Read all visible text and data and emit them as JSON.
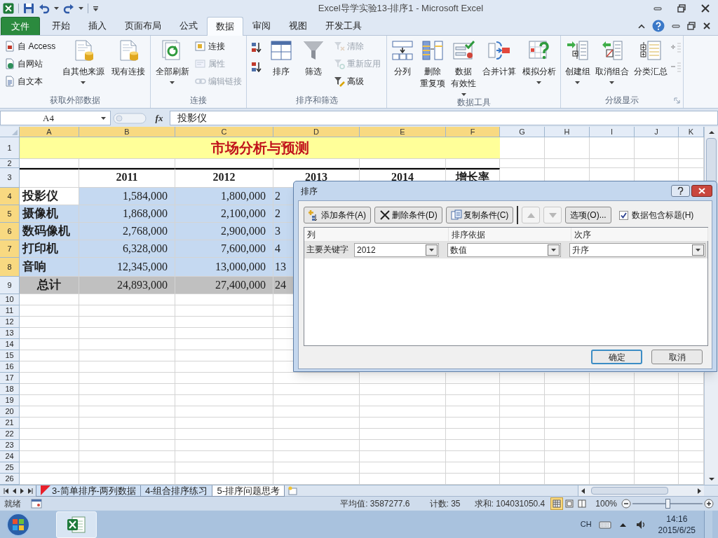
{
  "window": {
    "title": "Excel导学实验13-排序1  -  Microsoft Excel"
  },
  "ribbon_tabs": [
    {
      "label": "文件",
      "kind": "file",
      "selected": false
    },
    {
      "label": "开始",
      "kind": "tab",
      "selected": false
    },
    {
      "label": "插入",
      "kind": "tab",
      "selected": false
    },
    {
      "label": "页面布局",
      "kind": "tab",
      "selected": false
    },
    {
      "label": "公式",
      "kind": "tab",
      "selected": false
    },
    {
      "label": "数据",
      "kind": "tab",
      "selected": true
    },
    {
      "label": "审阅",
      "kind": "tab",
      "selected": false
    },
    {
      "label": "视图",
      "kind": "tab",
      "selected": false
    },
    {
      "label": "开发工具",
      "kind": "tab",
      "selected": false
    }
  ],
  "ribbon_groups": [
    {
      "label": "获取外部数据",
      "launcher": false,
      "items": [
        {
          "kind": "stack",
          "items": [
            {
              "label": "自 Access",
              "disabled": false
            },
            {
              "label": "自网站",
              "disabled": false
            },
            {
              "label": "自文本",
              "disabled": false
            }
          ]
        },
        {
          "kind": "large",
          "label": "自其他来源",
          "dropdown": true
        },
        {
          "kind": "large",
          "label": "现有连接",
          "dropdown": false
        }
      ]
    },
    {
      "label": "连接",
      "launcher": false,
      "items": [
        {
          "kind": "large",
          "label": "全部刷新",
          "dropdown": true
        },
        {
          "kind": "stack",
          "items": [
            {
              "label": "连接",
              "disabled": false
            },
            {
              "label": "属性",
              "disabled": true
            },
            {
              "label": "编辑链接",
              "disabled": true
            }
          ]
        }
      ]
    },
    {
      "label": "排序和筛选",
      "launcher": false,
      "items": [
        {
          "kind": "icon-stack",
          "items": [
            {
              "disabled": false
            },
            {
              "disabled": false
            }
          ]
        },
        {
          "kind": "large",
          "label": "排序",
          "dropdown": false
        },
        {
          "kind": "large",
          "label": "筛选",
          "dropdown": false
        },
        {
          "kind": "stack",
          "items": [
            {
              "label": "清除",
              "disabled": true
            },
            {
              "label": "重新应用",
              "disabled": true
            },
            {
              "label": "高级",
              "disabled": false
            }
          ]
        }
      ]
    },
    {
      "label": "数据工具",
      "launcher": false,
      "items": [
        {
          "kind": "large",
          "label": "分列",
          "dropdown": false
        },
        {
          "kind": "large",
          "lines": [
            "删除",
            "重复项"
          ],
          "dropdown": false
        },
        {
          "kind": "large",
          "lines": [
            "数据",
            "有效性"
          ],
          "dropdown": true
        },
        {
          "kind": "large",
          "label": "合并计算",
          "dropdown": false
        },
        {
          "kind": "large",
          "label": "模拟分析",
          "dropdown": true
        }
      ]
    },
    {
      "label": "分级显示",
      "launcher": true,
      "items": [
        {
          "kind": "large",
          "label": "创建组",
          "dropdown": true
        },
        {
          "kind": "large",
          "label": "取消组合",
          "dropdown": true
        },
        {
          "kind": "large",
          "label": "分类汇总",
          "dropdown": false
        },
        {
          "kind": "icon-stack",
          "items": [
            {
              "disabled": true
            },
            {
              "disabled": true
            }
          ]
        }
      ]
    }
  ],
  "formula_bar": {
    "name_box": "A4",
    "function_button": "fx",
    "formula": "投影仪"
  },
  "sheet": {
    "columns": [
      {
        "label": "A",
        "selected": true
      },
      {
        "label": "B",
        "selected": true
      },
      {
        "label": "C",
        "selected": true
      },
      {
        "label": "D",
        "selected": true
      },
      {
        "label": "E",
        "selected": true
      },
      {
        "label": "F",
        "selected": true
      },
      {
        "label": "G",
        "selected": false
      },
      {
        "label": "H",
        "selected": false
      },
      {
        "label": "I",
        "selected": false
      },
      {
        "label": "J",
        "selected": false
      },
      {
        "label": "K",
        "selected": false
      }
    ],
    "rows": [
      {
        "number": "1",
        "kind": "title",
        "selected": false,
        "cells": [
          {
            "text": "市场分析与预测"
          }
        ]
      },
      {
        "number": "2",
        "kind": "blank",
        "selected": false
      },
      {
        "number": "3",
        "kind": "header",
        "selected": false,
        "cells": [
          {
            "text": "2011"
          },
          {
            "text": "2012"
          },
          {
            "text": "2013"
          },
          {
            "text": "2014"
          },
          {
            "text": "增长率"
          }
        ]
      },
      {
        "number": "4",
        "kind": "data",
        "selected": true,
        "cells": [
          {
            "text": "投影仪",
            "selected": false
          },
          {
            "text": "1,584,000",
            "selected": true
          },
          {
            "text": "1,800,000",
            "selected": true
          },
          {
            "text": "2",
            "selected": true
          }
        ]
      },
      {
        "number": "5",
        "kind": "data",
        "selected": true,
        "cells": [
          {
            "text": "摄像机",
            "selected": true
          },
          {
            "text": "1,868,000",
            "selected": true
          },
          {
            "text": "2,100,000",
            "selected": true
          },
          {
            "text": "2",
            "selected": true
          }
        ]
      },
      {
        "number": "6",
        "kind": "data",
        "selected": true,
        "cells": [
          {
            "text": "数码像机",
            "selected": true
          },
          {
            "text": "2,768,000",
            "selected": true
          },
          {
            "text": "2,900,000",
            "selected": true
          },
          {
            "text": "3",
            "selected": true
          }
        ]
      },
      {
        "number": "7",
        "kind": "data",
        "selected": true,
        "cells": [
          {
            "text": "打印机",
            "selected": true
          },
          {
            "text": "6,328,000",
            "selected": true
          },
          {
            "text": "7,600,000",
            "selected": true
          },
          {
            "text": "4",
            "selected": true
          }
        ]
      },
      {
        "number": "8",
        "kind": "data",
        "selected": true,
        "cells": [
          {
            "text": "音响",
            "selected": true
          },
          {
            "text": "12,345,000",
            "selected": true
          },
          {
            "text": "13,000,000",
            "selected": true
          },
          {
            "text": "13",
            "selected": true
          }
        ]
      },
      {
        "number": "9",
        "kind": "total",
        "selected": false,
        "cells": [
          {
            "text": "总计"
          },
          {
            "text": "24,893,000"
          },
          {
            "text": "27,400,000"
          },
          {
            "text": "24"
          }
        ]
      },
      {
        "number": "10",
        "kind": "blank",
        "selected": false
      },
      {
        "number": "11",
        "kind": "blank",
        "selected": false
      },
      {
        "number": "12",
        "kind": "blank",
        "selected": false
      },
      {
        "number": "13",
        "kind": "blank",
        "selected": false
      },
      {
        "number": "14",
        "kind": "blank",
        "selected": false
      },
      {
        "number": "15",
        "kind": "blank",
        "selected": false
      },
      {
        "number": "16",
        "kind": "blank",
        "selected": false
      },
      {
        "number": "17",
        "kind": "blank",
        "selected": false
      },
      {
        "number": "18",
        "kind": "blank",
        "selected": false
      },
      {
        "number": "19",
        "kind": "blank",
        "selected": false
      },
      {
        "number": "20",
        "kind": "blank",
        "selected": false
      },
      {
        "number": "21",
        "kind": "blank",
        "selected": false
      },
      {
        "number": "22",
        "kind": "blank",
        "selected": false
      },
      {
        "number": "23",
        "kind": "blank",
        "selected": false
      },
      {
        "number": "24",
        "kind": "blank",
        "selected": false
      },
      {
        "number": "25",
        "kind": "blank",
        "selected": false
      },
      {
        "number": "26",
        "kind": "blank",
        "selected": false
      }
    ]
  },
  "sheet_tabs": [
    {
      "label": "3-简单排序-两列数据",
      "selected": false,
      "color": "#e8202a"
    },
    {
      "label": "4-组合排序练习",
      "selected": false
    },
    {
      "label": "5-排序问题思考",
      "selected": true
    }
  ],
  "status_bar": {
    "mode": "就绪",
    "average": "平均值: 3587277.6",
    "count": "计数: 35",
    "sum": "求和: 104031050.4",
    "views": [
      {
        "kind": "normal",
        "selected": true
      },
      {
        "kind": "page-layout",
        "selected": false
      },
      {
        "kind": "page-break",
        "selected": false
      }
    ],
    "zoom": "100%",
    "zoom_slider": {
      "level": 0.5
    }
  },
  "taskbar": {
    "language": "CH",
    "time": "14:16",
    "date": "2015/6/25"
  },
  "dialog": {
    "title": "排序",
    "toolbar": [
      {
        "kind": "button",
        "label": "添加条件(A)",
        "disabled": false
      },
      {
        "kind": "button",
        "label": "删除条件(D)",
        "disabled": false
      },
      {
        "kind": "button",
        "label": "复制条件(C)",
        "disabled": false
      },
      {
        "kind": "move-up",
        "disabled": true
      },
      {
        "kind": "move-down",
        "disabled": true
      },
      {
        "kind": "button",
        "label": "选项(O)...",
        "disabled": false
      }
    ],
    "has_headers": {
      "label": "数据包含标题(H)",
      "checked": true
    },
    "columns": [
      "列",
      "排序依据",
      "次序"
    ],
    "criteria": [
      {
        "label": "主要关键字",
        "column": "2012",
        "sort_on": "数值",
        "order": "升序",
        "selected": true
      }
    ],
    "footer_buttons": [
      {
        "label": "确定",
        "default": true
      },
      {
        "label": "取消",
        "default": false
      }
    ]
  }
}
